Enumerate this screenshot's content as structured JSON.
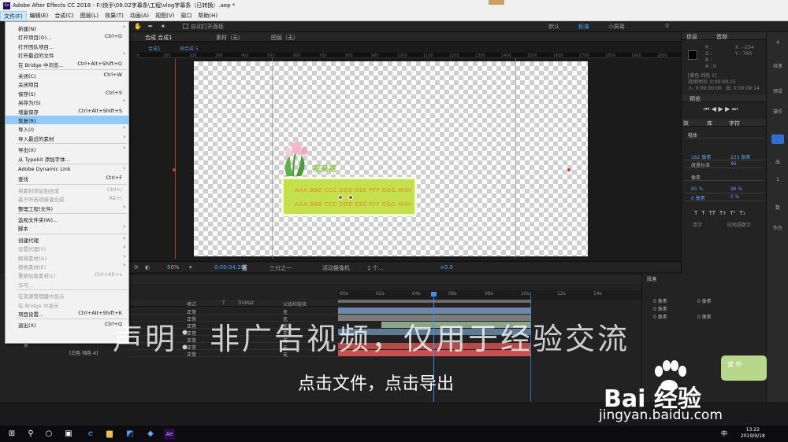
{
  "window": {
    "title": "Adobe After Effects CC 2018 - F:\\快手\\09.02字幕条\\工程\\vlog字幕条（已转换）.aep *"
  },
  "menubar": [
    "文件(F)",
    "编辑(E)",
    "合成(C)",
    "图层(L)",
    "效果(T)",
    "动画(A)",
    "视图(V)",
    "窗口",
    "帮助(H)"
  ],
  "toolbar": {
    "auto_open": "自动打开面板",
    "workspace": [
      "默认",
      "标准",
      "小屏幕"
    ]
  },
  "file_menu": [
    {
      "label": "新建(N)",
      "shortcut": "",
      "arrow": true
    },
    {
      "label": "打开项目(O)...",
      "shortcut": "Ctrl+O"
    },
    {
      "label": "打开团队项目...",
      "shortcut": ""
    },
    {
      "label": "打开最近的文件",
      "shortcut": "",
      "arrow": true
    },
    {
      "label": "在 Bridge 中浏览...",
      "shortcut": "Ctrl+Alt+Shift+O"
    },
    {
      "label": "关闭(C)",
      "shortcut": "Ctrl+W"
    },
    {
      "label": "关闭项目",
      "shortcut": ""
    },
    {
      "label": "保存(S)",
      "shortcut": "Ctrl+S"
    },
    {
      "label": "另存为(S)",
      "shortcut": "",
      "arrow": true
    },
    {
      "label": "增量保存",
      "shortcut": "Ctrl+Alt+Shift+S"
    },
    {
      "label": "恢复(R)",
      "shortcut": "",
      "highlight": true
    },
    {
      "label": "导入(I)",
      "shortcut": "",
      "arrow": true
    },
    {
      "label": "导入最近的素材",
      "shortcut": "",
      "arrow": true
    },
    {
      "label": "导出(X)",
      "shortcut": "",
      "arrow": true
    },
    {
      "label": "从 Typekit 添加字体...",
      "shortcut": ""
    },
    {
      "label": "Adobe Dynamic Link",
      "shortcut": "",
      "arrow": true
    },
    {
      "label": "查找",
      "shortcut": "Ctrl+F"
    },
    {
      "label": "将素材添加到合成",
      "shortcut": "Ctrl+/",
      "disabled": true
    },
    {
      "label": "基于所选项新建合成",
      "shortcut": "Alt+\\",
      "disabled": true
    },
    {
      "label": "整理工程(文件)",
      "shortcut": "",
      "arrow": true
    },
    {
      "label": "监视文件夹(W)...",
      "shortcut": ""
    },
    {
      "label": "脚本",
      "shortcut": "",
      "arrow": true
    },
    {
      "label": "创建代理",
      "shortcut": "",
      "arrow": true
    },
    {
      "label": "设置代理(Y)",
      "shortcut": "",
      "arrow": true,
      "disabled": true
    },
    {
      "label": "解释素材(G)",
      "shortcut": "",
      "arrow": true,
      "disabled": true
    },
    {
      "label": "替换素材(E)",
      "shortcut": "",
      "arrow": true,
      "disabled": true
    },
    {
      "label": "重新加载素材(L)",
      "shortcut": "Ctrl+Alt+L",
      "disabled": true
    },
    {
      "label": "许可...",
      "shortcut": "",
      "disabled": true
    },
    {
      "label": "在资源管理器中显示",
      "shortcut": "",
      "disabled": true
    },
    {
      "label": "在 Bridge 中显示",
      "shortcut": "",
      "disabled": true
    },
    {
      "label": "项目设置...",
      "shortcut": "Ctrl+Alt+Shift+K"
    },
    {
      "label": "退出(X)",
      "shortcut": "Ctrl+Q"
    }
  ],
  "comp": {
    "tabs": {
      "comp": "合成 合成1",
      "footage": "素材（无）",
      "layer": "图层（无）"
    },
    "subtabs": [
      "合成1",
      "预合成 5"
    ],
    "ruler_ticks": [
      "0",
      "100",
      "200",
      "300",
      "400",
      "500",
      "600",
      "700",
      "800",
      "900",
      "1000",
      "1100",
      "1200",
      "1300",
      "1400",
      "1500",
      "1600",
      "1700",
      "1800",
      "1900",
      "2000"
    ],
    "caption_title": "花朵花",
    "caption_lines": [
      "AAA BBB CCC DDD EEE FFF GGG HHH",
      "AAA BBB CCC DDD EEE FFF GGG HHH"
    ],
    "zoom": "50%",
    "timecode": "0:00:04:28",
    "resolution": "三分之一",
    "camera": "活动摄像机",
    "views": "1 个...",
    "exposure": "+0.0"
  },
  "info_panel": {
    "title": "信息",
    "audio": "音频",
    "coords": [
      "X : -234",
      "Y : 760"
    ],
    "rgba": [
      "R :",
      "G :",
      "B :",
      "A : 0"
    ],
    "layer_name": "[黄色 纯色 1]",
    "duration": "持续时间: 0:00:09:15",
    "in": "入: 0:00:00:00",
    "out": "出: 0:00:09:14"
  },
  "preview_panel": {
    "title": "预览"
  },
  "character_panel": {
    "tabs": [
      "效",
      "库",
      "字符"
    ],
    "font": "楷体",
    "size": "182 像素",
    "leading": "223 像素",
    "kerning": "度量标准",
    "tracking": "46",
    "stroke": "像素",
    "vscale": "95 %",
    "hscale": "96 %",
    "baseline": "0 像素",
    "tsume": "0 %",
    "styles": [
      "T",
      "T",
      "TT",
      "Tᴛ",
      "T¹",
      "T₁"
    ],
    "ligatures": "连字",
    "hindi": "印地语数字"
  },
  "far_right": {
    "items": [
      "4",
      "共享",
      "预设",
      "操作",
      "出",
      "1",
      "数",
      "作台"
    ]
  },
  "align_panel": {
    "title": "段落",
    "values": [
      "0 像素",
      "0 像素",
      "0 像素",
      "0 像素",
      "0 像素"
    ]
  },
  "timeline": {
    "columns": [
      "模式",
      "T",
      "TrkMat",
      "父级和链接"
    ],
    "rows": [
      {
        "mode": "正常",
        "parent": "无"
      },
      {
        "mode": "正常",
        "parent": "无"
      },
      {
        "mode": "正常",
        "parent": "无"
      },
      {
        "mode": "正常",
        "parent": "无"
      },
      {
        "mode": "正常",
        "parent": "无"
      },
      {
        "mode": "正常",
        "parent": "无"
      },
      {
        "mode": "正常",
        "parent": "无"
      }
    ],
    "ruler_ticks": [
      "00s",
      "02s",
      "04s",
      "06s",
      "08s",
      "10s",
      "12s",
      "14s"
    ],
    "layer_labels": [
      "景",
      "[白色 纯色 4]"
    ],
    "timeline_label": "列"
  },
  "overlay": {
    "watermark": "声明：非广告视频，仅用于经验交流",
    "subtitle": "点击文件，点击导出",
    "baidu_logo": "Bai 经验",
    "baidu_url": "jingyan.baidu.com",
    "frog_text": "黛 中"
  },
  "taskbar": {
    "time": "13:22",
    "date": "2019/9/18",
    "ime": "中"
  },
  "colors": {
    "menu_highlight": "#91c9f7",
    "ae_accent": "#3d8ee6",
    "caption_box": "#c4e04a",
    "caption_text": "#e08a35"
  }
}
